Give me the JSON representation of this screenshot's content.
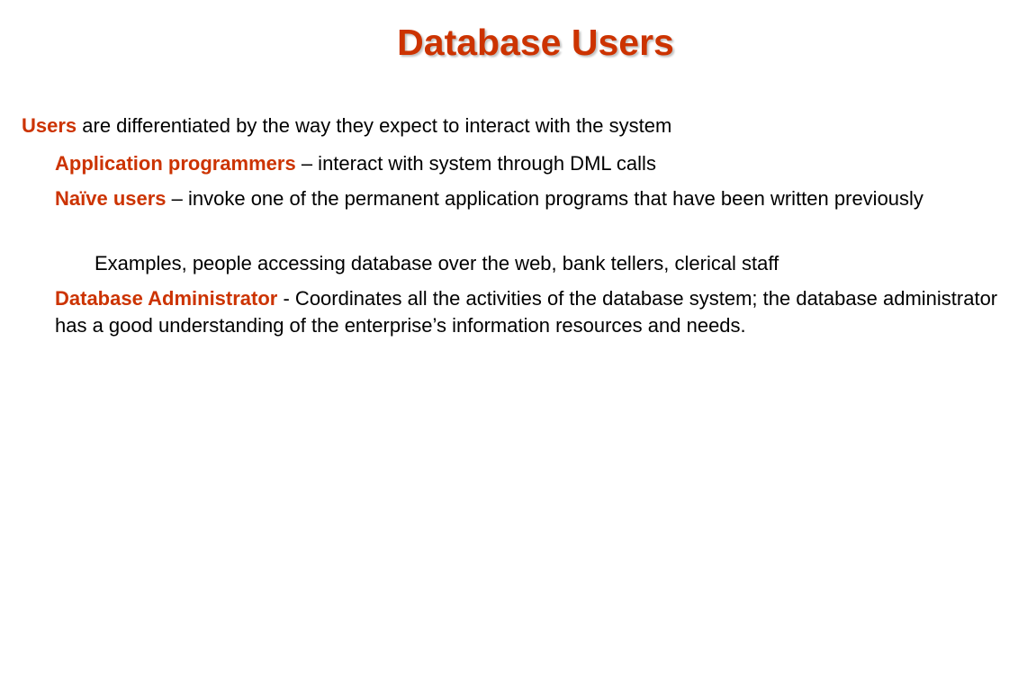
{
  "title": "Database Users",
  "intro": {
    "term": "Users",
    "text": " are differentiated by the way they expect to interact with  the system"
  },
  "items": [
    {
      "term": "Application programmers",
      "text": " – interact with system through DML calls"
    },
    {
      "term": "Naïve users",
      "text": " – invoke one of the permanent application programs that have been written previously",
      "sub": "Examples, people accessing database over the web, bank tellers, clerical staff"
    },
    {
      "term": "Database Administrator",
      "text": " - Coordinates all the activities of the database system; the database administrator has a good understanding of the enterprise’s information resources and needs."
    }
  ],
  "colors": {
    "accent": "#cc3300"
  }
}
